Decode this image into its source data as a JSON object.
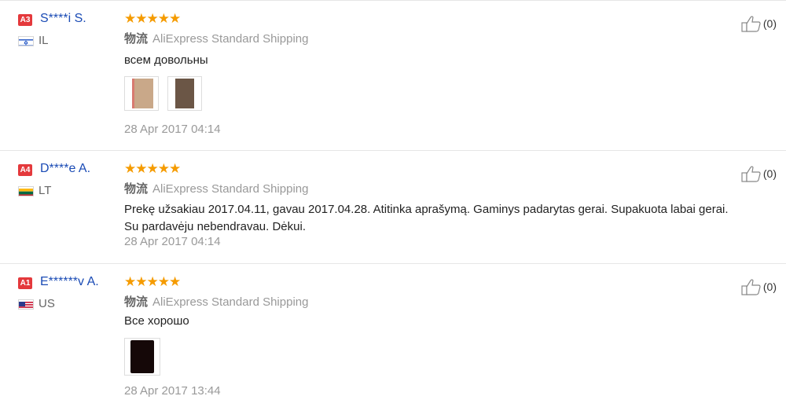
{
  "reviews": [
    {
      "badge": "A3",
      "badge_color": "#e4393c",
      "user": "S****i S.",
      "country": "IL",
      "flag": "il",
      "shipping_label": "物流",
      "shipping": "AliExpress Standard Shipping",
      "text": "всем довольны",
      "photos": [
        {
          "color": "#c9a889"
        },
        {
          "color": "#6b5646"
        }
      ],
      "date": "28 Apr 2017 04:14",
      "useful": "(0)"
    },
    {
      "badge": "A4",
      "badge_color": "#e4393c",
      "user": "D****e A.",
      "country": "LT",
      "flag": "lt",
      "shipping_label": "物流",
      "shipping": "AliExpress Standard Shipping",
      "text": "Prekę užsakiau 2017.04.11, gavau 2017.04.28. Atitinka aprašymą. Gaminys padarytas gerai. Supakuota labai gerai. Su pardavėju nebendravau. Dėkui.",
      "photos": [],
      "date": "28 Apr 2017 04:14",
      "useful": "(0)"
    },
    {
      "badge": "A1",
      "badge_color": "#e4393c",
      "user": "E******v A.",
      "country": "US",
      "flag": "us",
      "shipping_label": "物流",
      "shipping": "AliExpress Standard Shipping",
      "text": "Все хорошо",
      "photos": [
        {
          "color": "#150808"
        }
      ],
      "date": "28 Apr 2017 13:44",
      "useful": "(0)"
    }
  ]
}
